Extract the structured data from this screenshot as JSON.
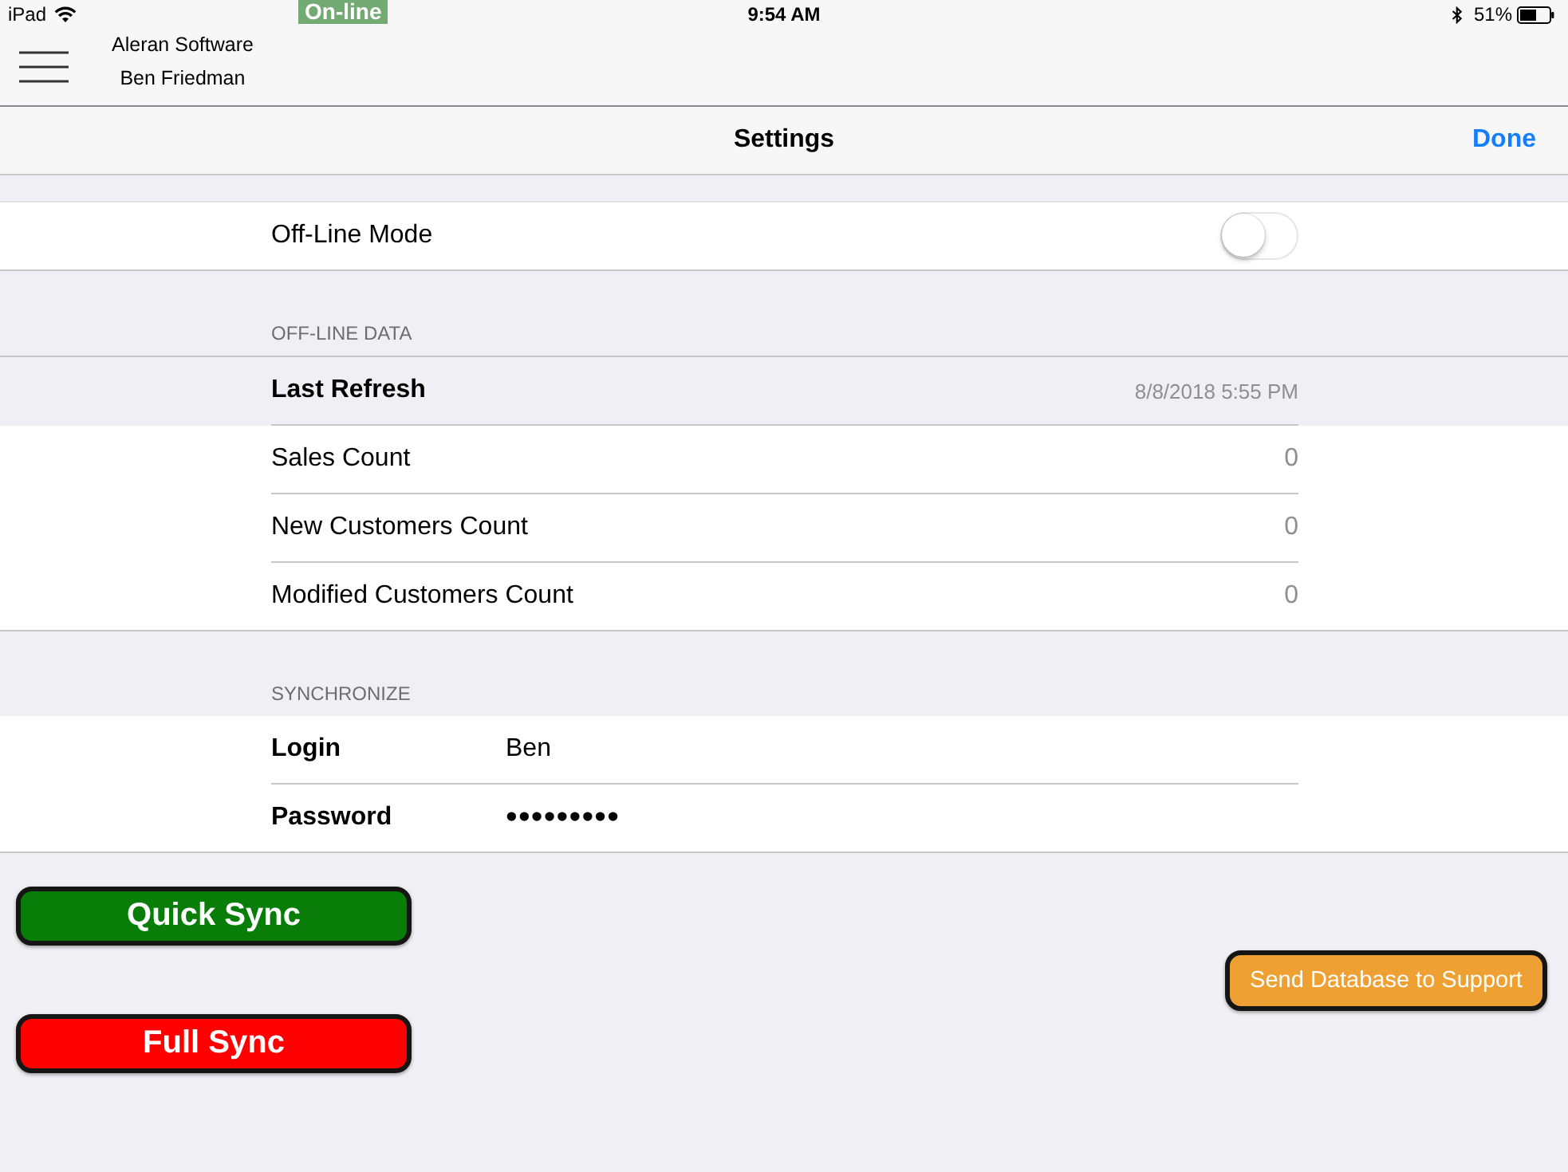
{
  "status_bar": {
    "device": "iPad",
    "connection": "On-line",
    "time": "9:54 AM",
    "battery": "51%"
  },
  "header": {
    "company": "Aleran Software",
    "user": "Ben Friedman"
  },
  "nav_bar": {
    "title": "Settings",
    "done": "Done"
  },
  "offline_mode": {
    "label": "Off-Line Mode",
    "on": false
  },
  "offline_data": {
    "header": "OFF-LINE DATA",
    "rows": [
      {
        "kind": "summary",
        "label": "Last Refresh",
        "value": "8/8/2018 5:55 PM"
      },
      {
        "kind": "count",
        "label": "Sales Count",
        "value": "0"
      },
      {
        "kind": "count",
        "label": "New Customers Count",
        "value": "0"
      },
      {
        "kind": "count",
        "label": "Modified Customers Count",
        "value": "0"
      }
    ]
  },
  "synchronize": {
    "header": "SYNCHRONIZE",
    "fields": [
      {
        "kind": "text",
        "label": "Login",
        "value": "Ben"
      },
      {
        "kind": "password",
        "label": "Password",
        "value": "•••••••••"
      }
    ]
  },
  "sync_buttons": [
    {
      "label": "Quick Sync",
      "color": "#087d08"
    },
    {
      "label": "Full Sync",
      "color": "#fe0000"
    }
  ],
  "support_button": {
    "label": "Send Database to Support"
  }
}
